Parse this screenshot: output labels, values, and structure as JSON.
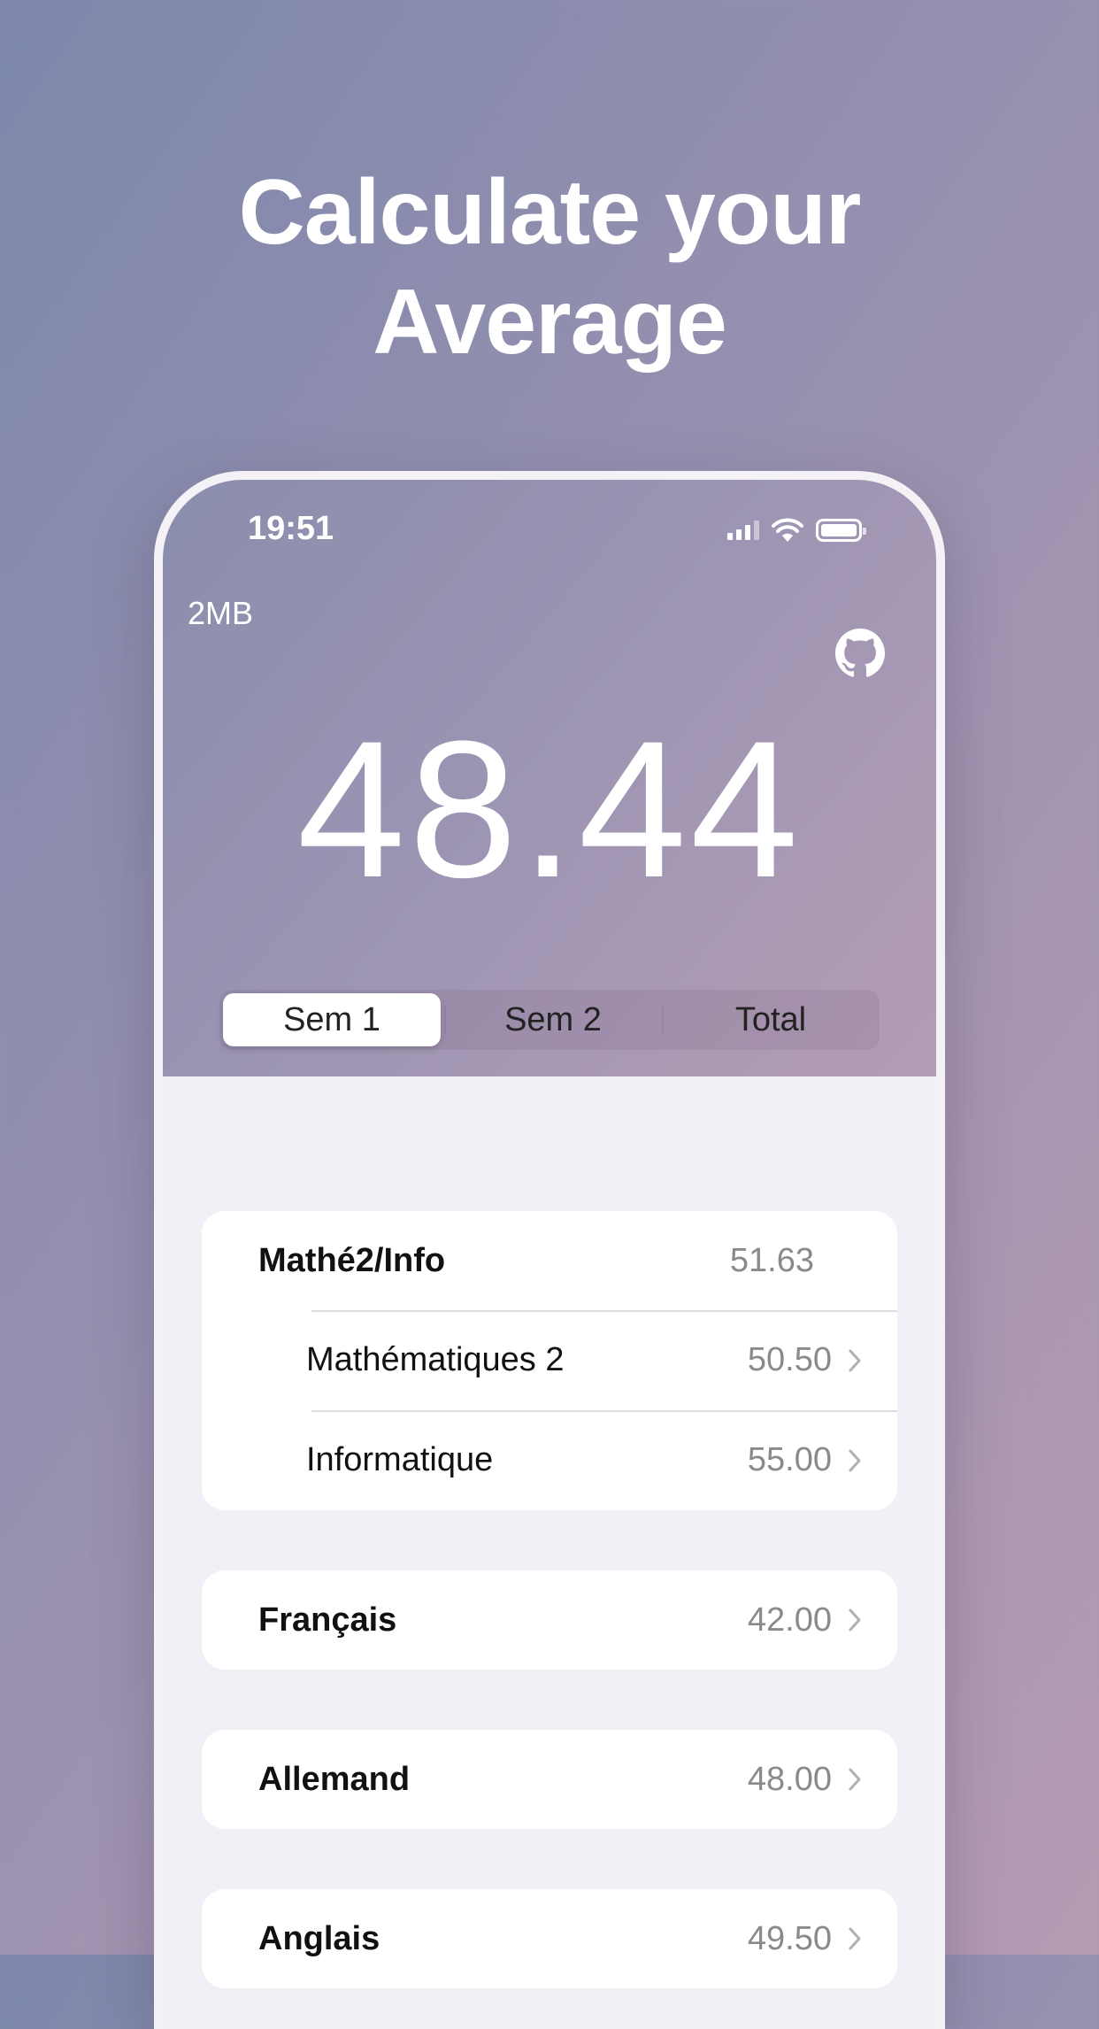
{
  "headline": [
    "Calculate your",
    "Average"
  ],
  "status_bar": {
    "time": "19:51"
  },
  "app": {
    "name": "2MB",
    "github_icon": "github-icon"
  },
  "average": "48.44",
  "segments": [
    {
      "label": "Sem 1",
      "selected": true
    },
    {
      "label": "Sem 2",
      "selected": false
    },
    {
      "label": "Total",
      "selected": false
    }
  ],
  "groups": [
    {
      "title": "Mathé2/Info",
      "value": "51.63",
      "items": [
        {
          "label": "Mathématiques 2",
          "value": "50.50"
        },
        {
          "label": "Informatique",
          "value": "55.00"
        }
      ]
    },
    {
      "title": "Français",
      "value": "42.00"
    },
    {
      "title": "Allemand",
      "value": "48.00"
    },
    {
      "title": "Anglais",
      "value": "49.50"
    }
  ]
}
